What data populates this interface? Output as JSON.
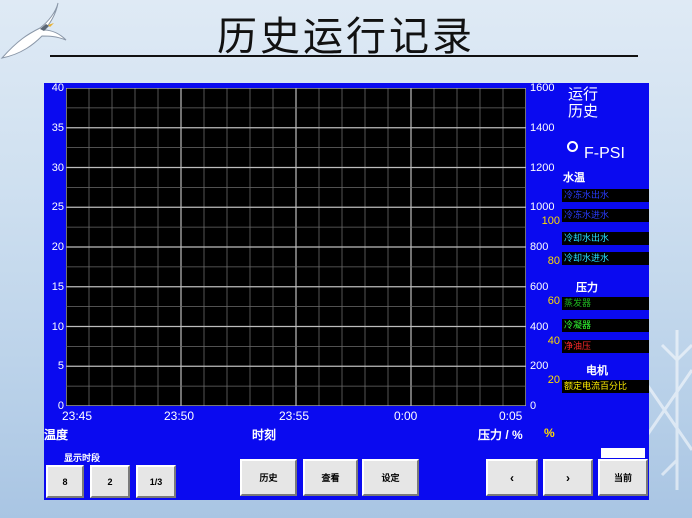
{
  "header": {
    "title": "历史运行记录"
  },
  "chart": {
    "y_left_ticks": [
      "40",
      "35",
      "30",
      "25",
      "20",
      "15",
      "10",
      "5",
      "0"
    ],
    "y_right_ticks": [
      "1600",
      "1400",
      "1200",
      "1000",
      "800",
      "600",
      "400",
      "200",
      "0"
    ],
    "y_right_extra": [
      "100",
      "80",
      "60",
      "40",
      "20"
    ],
    "x_ticks": [
      "23:45",
      "23:50",
      "23:55",
      "0:00",
      "0:05"
    ],
    "left_axis_label": "温度",
    "x_axis_label": "时刻",
    "right_axis_label": "压力 / %",
    "pct_label": "%"
  },
  "chart_data": {
    "type": "line",
    "x": [
      "23:45",
      "23:50",
      "23:55",
      "0:00",
      "0:05"
    ],
    "xlabel": "时刻",
    "ylabel": "温度",
    "ylim": [
      0,
      40
    ],
    "y2label": "压力 / %",
    "y2lim": [
      0,
      1600
    ],
    "grid": true,
    "series": []
  },
  "side_panel": {
    "header": "运行\n历史",
    "unit": "F-PSI",
    "water_temp_label": "水温",
    "items_water": [
      {
        "label": "冷冻水出水",
        "color": "#2a3cff"
      },
      {
        "label": "冷冻水进水",
        "color": "#2a3cff"
      },
      {
        "label": "冷却水出水",
        "color": "#29e0ff"
      },
      {
        "label": "冷却水进水",
        "color": "#29e0ff"
      }
    ],
    "pressure_label": "压力",
    "items_pressure": [
      {
        "label": "蒸发器",
        "color": "#1fb41f"
      },
      {
        "label": "冷凝器",
        "color": "#33ff33"
      },
      {
        "label": "净油压",
        "color": "#ff2a2a"
      }
    ],
    "motor_label": "电机",
    "items_motor": [
      {
        "label": "额定电流百分比",
        "color": "#ffee00"
      }
    ]
  },
  "toolbar": {
    "period_label": "显示时段",
    "btn_8": "8",
    "btn_2": "2",
    "btn_third": "1/3",
    "btn_history": "历史",
    "btn_view": "查看",
    "btn_settings": "设定",
    "btn_prev": "‹",
    "btn_next": "›",
    "btn_current": "当前"
  }
}
